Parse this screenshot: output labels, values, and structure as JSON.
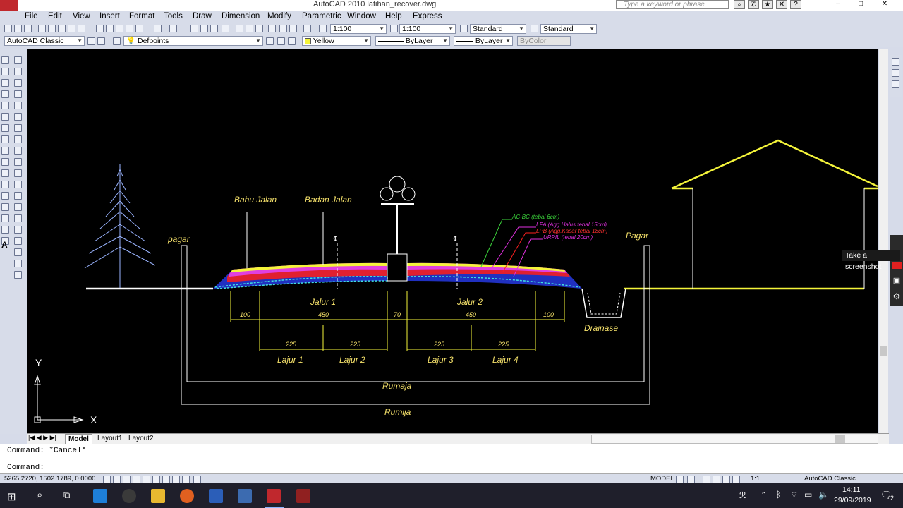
{
  "window": {
    "title": "AutoCAD 2010    latihan_recover.dwg",
    "search_placeholder": "Type a keyword or phrase"
  },
  "menubar": [
    "File",
    "Edit",
    "View",
    "Insert",
    "Format",
    "Tools",
    "Draw",
    "Dimension",
    "Modify",
    "Parametric",
    "Window",
    "Help",
    "Express"
  ],
  "toolbar1": {
    "scale1": "1:100",
    "scale2": "1:100",
    "textstyle": "Standard",
    "dimstyle": "Standard"
  },
  "toolbar2": {
    "workspace": "AutoCAD Classic",
    "layer": "Defpoints",
    "color": "Yellow",
    "linetype": "ByLayer",
    "lineweight": "ByLayer",
    "plotstyle": "ByColor"
  },
  "drawing": {
    "labels": {
      "bahu_jalan": "Bahu Jalan",
      "badan_jalan": "Badan Jalan",
      "pagar_left": "pagar",
      "pagar_right": "Pagar",
      "jalur1": "Jalur 1",
      "jalur2": "Jalur 2",
      "drainase": "Drainase",
      "lajur1": "Lajur 1",
      "lajur2": "Lajur 2",
      "lajur3": "Lajur 3",
      "lajur4": "Lajur 4",
      "rumaja": "Rumaja",
      "rumija": "Rumija",
      "cl": "℄"
    },
    "layers_legend": {
      "acbc": "AC-BC (tebal 6cm)",
      "lpa": "LPA (Agg.Halus tebal 15cm)",
      "lpb": "LPB (Agg.Kasar tebal 18cm)",
      "urpil": "URPIL (tebal 20cm)"
    },
    "dims_top": {
      "d1": "100",
      "d2": "450",
      "d3": "70",
      "d4": "450",
      "d5": "100"
    },
    "dims_bottom": {
      "d1": "225",
      "d2": "225",
      "d3": "225",
      "d4": "225"
    },
    "ucs": {
      "x": "X",
      "y": "Y"
    }
  },
  "tabs": [
    "Model",
    "Layout1",
    "Layout2"
  ],
  "command": {
    "history": "Command: *Cancel*",
    "prompt": "Command:"
  },
  "status": {
    "coords": "5265.2720, 1502.1789, 0.0000",
    "mode": "MODEL",
    "annoscale": "1:1",
    "workspace": "AutoCAD Classic"
  },
  "taskbar": {
    "time": "14:11",
    "date": "29/09/2019",
    "notification_count": "2"
  },
  "tooltip": "Take a screenshot",
  "colors": {
    "yellow": "#f4f43a",
    "green": "#3bd43b",
    "magenta": "#e030e0",
    "red": "#ff2020",
    "cyan": "#40e0e0",
    "blue": "#3050ff"
  }
}
